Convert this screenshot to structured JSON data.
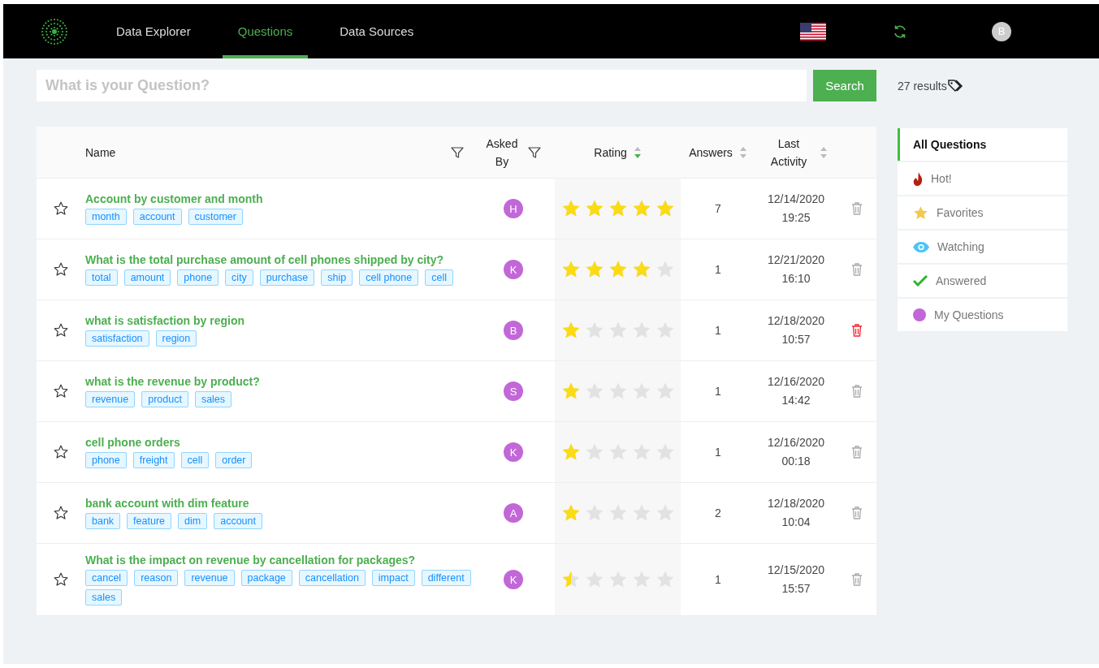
{
  "nav": {
    "tabs": [
      {
        "label": "Data Explorer",
        "selected": false
      },
      {
        "label": "Questions",
        "selected": true
      },
      {
        "label": "Data Sources",
        "selected": false
      }
    ],
    "user_initial": "B"
  },
  "search": {
    "placeholder": "What is your Question?",
    "button": "Search"
  },
  "results": "27 results",
  "table": {
    "columns": [
      {
        "label": "Name",
        "filter": true,
        "sortable": false
      },
      {
        "label": "Asked By",
        "filter": true,
        "sortable": false
      },
      {
        "label": "Rating",
        "filter": false,
        "sortable": true,
        "sorted_desc": true
      },
      {
        "label": "Answers",
        "filter": false,
        "sortable": true,
        "sorted_desc": false
      },
      {
        "label": "Last Activity",
        "filter": false,
        "sortable": true,
        "sorted_desc": false
      }
    ],
    "rows": [
      {
        "favorite": false,
        "title": "Account by customer and month",
        "tags": [
          "month",
          "account",
          "customer"
        ],
        "asked_by": "H",
        "stars": 5,
        "answers": "7",
        "date": "12/14/2020",
        "time": "19:25",
        "delete_active": false
      },
      {
        "favorite": false,
        "title": "What is the total purchase amount of cell phones shipped by city?",
        "tags": [
          "total",
          "amount",
          "phone",
          "city",
          "purchase",
          "ship",
          "cell phone",
          "cell"
        ],
        "asked_by": "K",
        "stars": 4,
        "answers": "1",
        "date": "12/21/2020",
        "time": "16:10",
        "delete_active": false
      },
      {
        "favorite": false,
        "title": "what is satisfaction by region",
        "tags": [
          "satisfaction",
          "region"
        ],
        "asked_by": "B",
        "stars": 1,
        "answers": "1",
        "date": "12/18/2020",
        "time": "10:57",
        "delete_active": true
      },
      {
        "favorite": false,
        "title": "what is the revenue by product?",
        "tags": [
          "revenue",
          "product",
          "sales"
        ],
        "asked_by": "S",
        "stars": 1,
        "answers": "1",
        "date": "12/16/2020",
        "time": "14:42",
        "delete_active": false
      },
      {
        "favorite": false,
        "title": "cell phone orders",
        "tags": [
          "phone",
          "freight",
          "cell",
          "order"
        ],
        "asked_by": "K",
        "stars": 1,
        "answers": "1",
        "date": "12/16/2020",
        "time": "00:18",
        "delete_active": false
      },
      {
        "favorite": false,
        "title": "bank account with dim feature",
        "tags": [
          "bank",
          "feature",
          "dim",
          "account"
        ],
        "asked_by": "A",
        "stars": 1,
        "answers": "2",
        "date": "12/18/2020",
        "time": "10:04",
        "delete_active": false
      },
      {
        "favorite": false,
        "title": "What is the impact on revenue by cancellation for packages?",
        "tags": [
          "cancel",
          "reason",
          "revenue",
          "package",
          "cancellation",
          "impact",
          "different",
          "sales"
        ],
        "asked_by": "K",
        "stars": 0.5,
        "answers": "1",
        "date": "12/15/2020",
        "time": "15:57",
        "delete_active": false
      }
    ]
  },
  "filters": [
    {
      "label": "All Questions",
      "kind": "all",
      "selected": true
    },
    {
      "label": "Hot!",
      "kind": "hot",
      "selected": false
    },
    {
      "label": "Favorites",
      "kind": "favorites",
      "selected": false
    },
    {
      "label": "Watching",
      "kind": "watching",
      "selected": false
    },
    {
      "label": "Answered",
      "kind": "answered",
      "selected": false
    },
    {
      "label": "My Questions",
      "kind": "mine",
      "selected": false
    }
  ]
}
